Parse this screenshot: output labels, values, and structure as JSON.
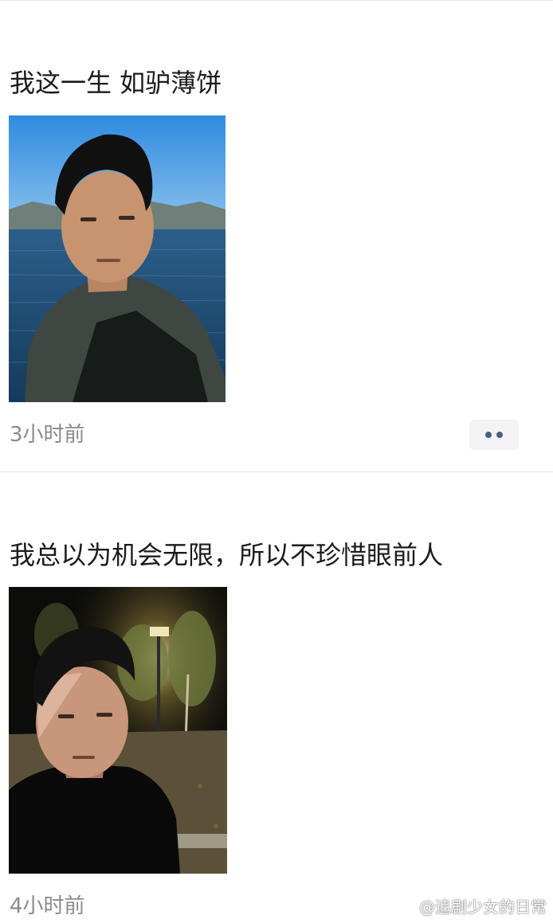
{
  "feed": {
    "posts": [
      {
        "text": "我这一生 如驴薄饼",
        "image_alt": "selfie-lakeside-man",
        "time": "3小时前",
        "more_icon": "more-dots-icon"
      },
      {
        "text": "我总以为机会无限，所以不珍惜眼前人",
        "image_alt": "selfie-night-park-man",
        "time": "4小时前",
        "more_icon": "more-dots-icon"
      }
    ]
  },
  "watermark": {
    "icon": "weibo-icon",
    "text": "@追剧少女的日常"
  },
  "colors": {
    "time_text": "#8a8a8a",
    "more_button_bg": "#f3f3f5",
    "more_dots": "#4f5c7f",
    "divider": "#e3e3e3"
  }
}
